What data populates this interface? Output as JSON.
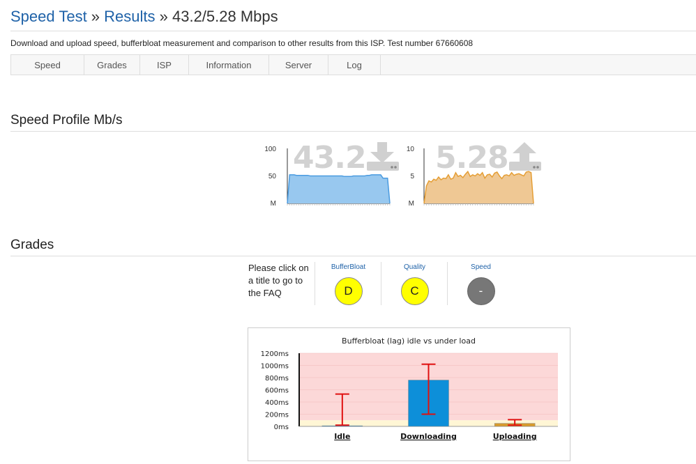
{
  "header": {
    "crumb1": "Speed Test",
    "sep1": " » ",
    "crumb2": "Results",
    "sep2": " » ",
    "result": "43.2/5.28 Mbps"
  },
  "description": "Download and upload speed, bufferbloat measurement and comparison to other results from this ISP. Test number 67660608",
  "tabs": [
    "Speed",
    "Grades",
    "ISP",
    "Information",
    "Server",
    "Log"
  ],
  "speed_profile": {
    "heading": "Speed Profile Mb/s",
    "download": {
      "value": "43.2",
      "icon": "download-icon",
      "color": "#4a9be0",
      "fill": "#98c8ef",
      "y_ticks": [
        "100",
        "50",
        "M"
      ],
      "y_max": 100,
      "samples": [
        0,
        52,
        52,
        52,
        51,
        51,
        51,
        51,
        51,
        51,
        50,
        50,
        50,
        50,
        50,
        50,
        50,
        50,
        50,
        50,
        50,
        50,
        50,
        50,
        50,
        49,
        49,
        49,
        49,
        50,
        50,
        50,
        50,
        50,
        50,
        51,
        51,
        52,
        52,
        52,
        52,
        52,
        46,
        46,
        46,
        0
      ]
    },
    "upload": {
      "value": "5.28",
      "icon": "upload-icon",
      "color": "#e59e34",
      "fill": "#efc894",
      "y_ticks": [
        "10",
        "5",
        "M"
      ],
      "y_max": 10,
      "samples": [
        0,
        3.2,
        4.1,
        3.9,
        4.4,
        4.2,
        4.8,
        4.3,
        4.6,
        4.5,
        5.2,
        4.4,
        4.6,
        5.6,
        4.9,
        5.1,
        4.7,
        5.3,
        5.8,
        4.9,
        5.2,
        5.0,
        5.4,
        5.1,
        5.6,
        4.6,
        5.2,
        5.3,
        4.8,
        5.5,
        5.7,
        5.0,
        4.5,
        5.1,
        5.2,
        5.0,
        5.6,
        5.1,
        5.3,
        5.4,
        5.2,
        5.0,
        5.7,
        5.8,
        5.6,
        0
      ]
    }
  },
  "grades": {
    "heading": "Grades",
    "note": "Please click on a title to go to the FAQ",
    "items": [
      {
        "title": "BufferBloat",
        "grade": "D",
        "color": "#ffff00"
      },
      {
        "title": "Quality",
        "grade": "C",
        "color": "#ffff00"
      },
      {
        "title": "Speed",
        "grade": "-",
        "color": "#777777"
      }
    ]
  },
  "chart_data": {
    "type": "bar",
    "title": "Bufferbloat (lag) idle vs under load",
    "categories": [
      "Idle",
      "Downloading",
      "Uploading"
    ],
    "values": [
      10,
      760,
      50
    ],
    "error_low": [
      20,
      200,
      20
    ],
    "error_high": [
      530,
      1020,
      110
    ],
    "colors": [
      "#0d8fd9",
      "#0d8fd9",
      "#d69a2d"
    ],
    "ylim": [
      0,
      1200
    ],
    "y_ticks": [
      "1200ms",
      "1000ms",
      "800ms",
      "600ms",
      "400ms",
      "200ms",
      "0ms"
    ],
    "band_good_max": 100,
    "band_good_color": "#fff6d5",
    "band_bad_color": "#fcd8d8",
    "grid": true
  }
}
